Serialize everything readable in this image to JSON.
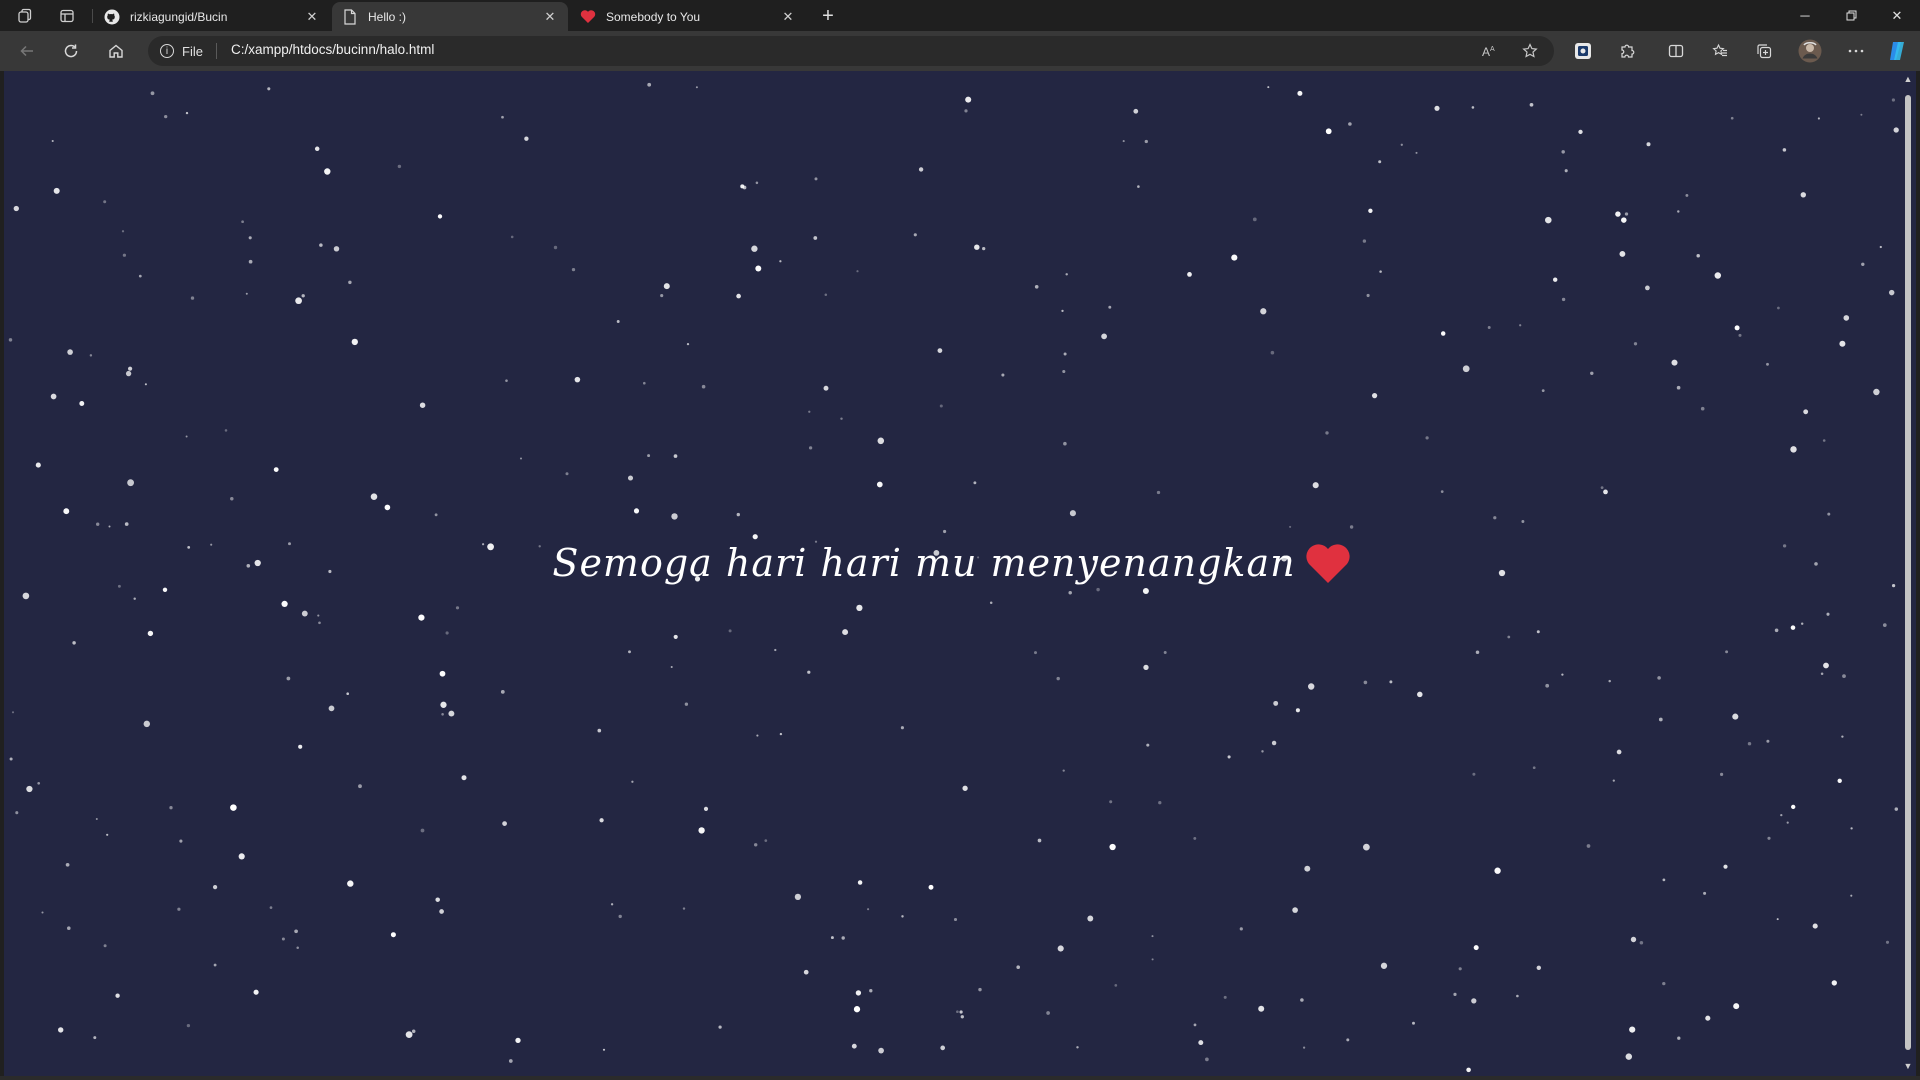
{
  "browser": {
    "tabs": [
      {
        "title": "rizkiagungid/Bucin",
        "icon": "github-icon",
        "active": false
      },
      {
        "title": "Hello :)",
        "icon": "page-icon",
        "active": true
      },
      {
        "title": "Somebody to You",
        "icon": "heart-icon",
        "active": false
      }
    ],
    "address": {
      "scheme_label": "File",
      "url": "C:/xampp/htdocs/bucinn/halo.html"
    }
  },
  "page": {
    "message": "Semoga hari hari mu menyenangkan",
    "background_color": "#232642",
    "heart_color": "#e0313f"
  }
}
